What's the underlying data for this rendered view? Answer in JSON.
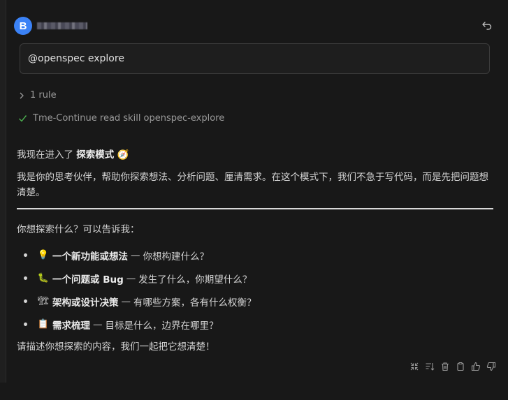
{
  "header": {
    "avatar_letter": "B",
    "avatar_color": "#3b82f6"
  },
  "prompt": {
    "text": "@openspec explore"
  },
  "rules": {
    "toggle_label": "1 rule"
  },
  "skill": {
    "status": "completed",
    "label": "Tme-Continue read skill openspec-explore"
  },
  "response": {
    "intro_prefix": "我现在进入了",
    "intro_mode": "探索模式",
    "intro_emoji": "🧭",
    "paragraph": "我是你的思考伙伴，帮助你探索想法、分析问题、厘清需求。在这个模式下，我们不急于写代码，而是先把问题想清楚。",
    "question": "你想探索什么？可以告诉我：",
    "items": [
      {
        "emoji": "💡",
        "title": "一个新功能或想法",
        "dash": "—",
        "desc": "你想构建什么？"
      },
      {
        "emoji": "🐛",
        "title": "一个问题或 Bug",
        "dash": "—",
        "desc": "发生了什么，你期望什么？"
      },
      {
        "emoji": "🏗",
        "title": "架构或设计决策",
        "dash": "—",
        "desc": "有哪些方案，各有什么权衡？"
      },
      {
        "emoji": "📋",
        "title": "需求梳理",
        "dash": "—",
        "desc": "目标是什么，边界在哪里？"
      }
    ],
    "closing": "请描述你想探索的内容，我们一起把它想清楚！"
  },
  "actions": [
    "collapse-icon",
    "sort-icon",
    "trash-icon",
    "copy-icon",
    "thumbs-up-icon",
    "thumbs-down-icon"
  ]
}
